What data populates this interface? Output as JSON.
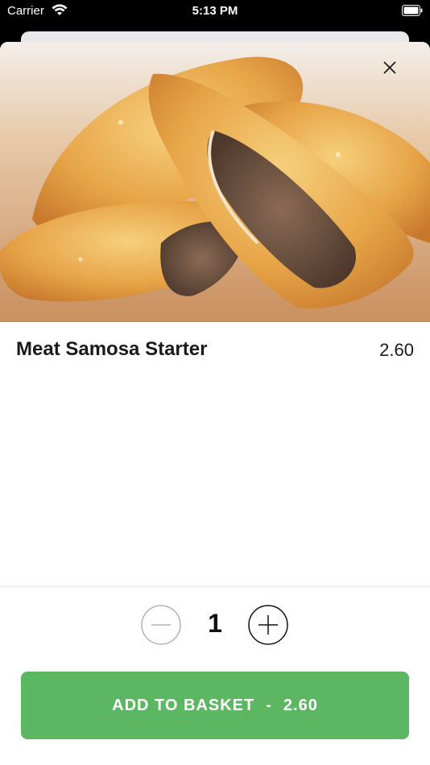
{
  "status_bar": {
    "carrier": "Carrier",
    "time": "5:13 PM"
  },
  "item": {
    "name": "Meat Samosa Starter",
    "price": "2.60"
  },
  "quantity": {
    "value": "1"
  },
  "add_button": {
    "label": "ADD TO BASKET",
    "separator": "-",
    "total": "2.60"
  },
  "colors": {
    "accent": "#5cb763",
    "text": "#1a1a1a"
  },
  "icons": [
    "wifi-icon",
    "battery-icon",
    "close-icon",
    "minus-icon",
    "plus-icon"
  ]
}
